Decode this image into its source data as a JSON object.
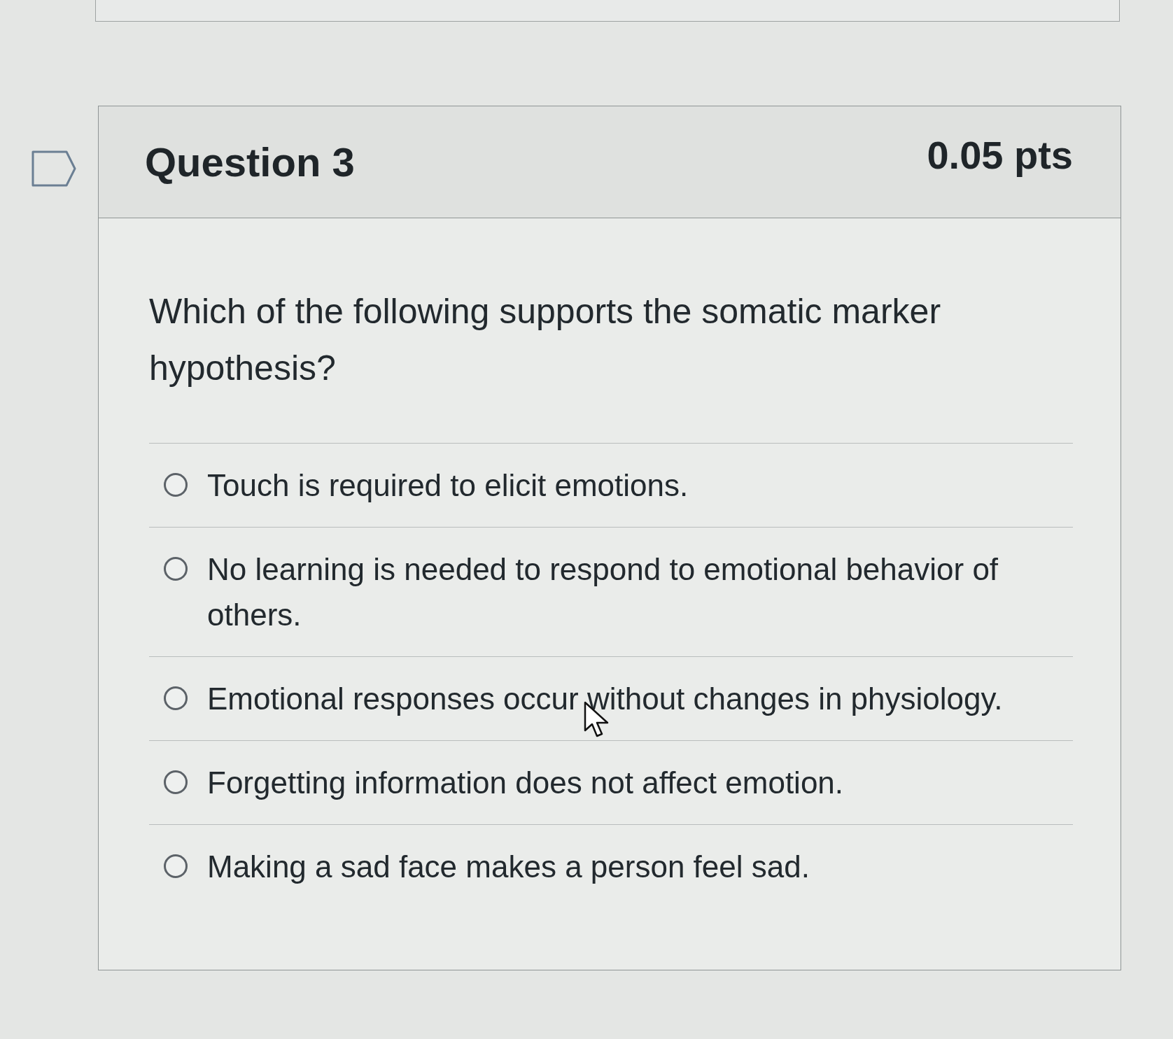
{
  "question": {
    "title": "Question 3",
    "points": "0.05 pts",
    "flagged": false,
    "text": "Which of the following supports the somatic marker hypothesis?"
  },
  "answers": [
    {
      "label": "Touch is required to elicit emotions.",
      "selected": false
    },
    {
      "label": "No learning is needed to respond to emotional behavior of others.",
      "selected": false
    },
    {
      "label": "Emotional responses occur without changes in physiology.",
      "selected": false
    },
    {
      "label": "Forgetting information does not affect emotion.",
      "selected": false
    },
    {
      "label": "Making a sad face makes a person feel sad.",
      "selected": false
    }
  ]
}
